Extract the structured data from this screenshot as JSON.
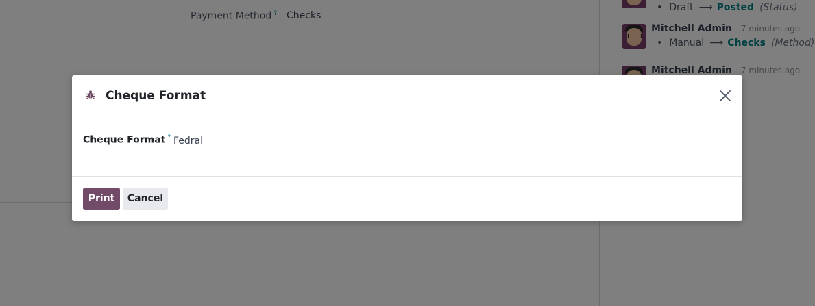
{
  "background": {
    "field": {
      "label": "Payment Method",
      "help": "?",
      "value": "Checks"
    },
    "chatter": {
      "messages": [
        {
          "author": "",
          "time": "",
          "old_value": "Draft",
          "new_value": "Posted",
          "field": "(Status)"
        },
        {
          "author": "Mitchell Admin",
          "time": "- 7 minutes ago",
          "old_value": "Manual",
          "new_value": "Checks",
          "field": "(Method)"
        },
        {
          "author": "Mitchell Admin",
          "time": "- 7 minutes ago"
        }
      ],
      "bullet": "•",
      "arrow": "⟶"
    }
  },
  "dialog": {
    "title": "Cheque Format",
    "icon": "bug-icon",
    "close_icon": "close-icon",
    "field": {
      "label": "Cheque Format",
      "help": "?",
      "value": "Fedral"
    },
    "buttons": {
      "print": "Print",
      "cancel": "Cancel"
    }
  },
  "colors": {
    "primary": "#714b67",
    "secondary_button": "#e7e9ed",
    "link": "#017e84",
    "backdrop": "rgba(0,0,0,0.5)"
  }
}
